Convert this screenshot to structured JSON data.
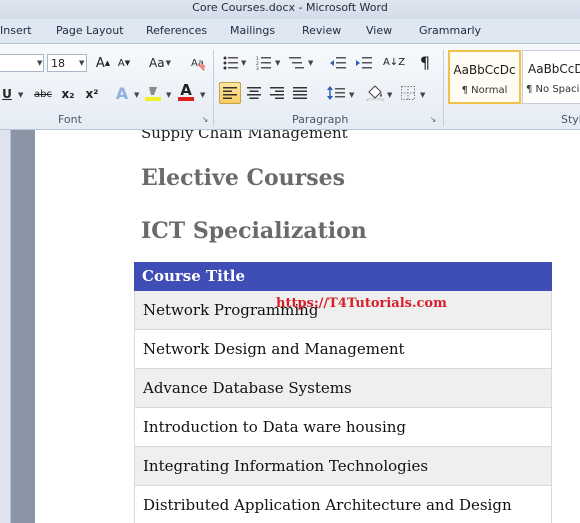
{
  "window": {
    "title": "Core Courses.docx - Microsoft Word"
  },
  "ribbon_tabs": [
    "Insert",
    "Page Layout",
    "References",
    "Mailings",
    "Review",
    "View",
    "Grammarly"
  ],
  "font_group": {
    "size": "18",
    "label": "Font",
    "change_case": "Aa",
    "grow_font": "A",
    "shrink_font": "A",
    "underline": "U",
    "strike": "abc",
    "subscript": "x₂",
    "superscript": "x²",
    "effects": "A",
    "font_color": "A"
  },
  "paragraph_group": {
    "label": "Paragraph",
    "sort": "A↓Z",
    "pilcrow": "¶"
  },
  "styles_group": {
    "label": "Styl",
    "items": [
      {
        "sample": "AaBbCcDc",
        "name": "¶ Normal"
      },
      {
        "sample": "AaBbCcDc",
        "name": "¶ No Spaci"
      }
    ]
  },
  "document": {
    "cut_line": "Supply Chain Management",
    "heading1": "Elective Courses",
    "heading2": "ICT Specialization",
    "table_header": "Course Title",
    "rows": [
      "Network Programming",
      "Network Design and Management",
      "Advance Database Systems",
      "Introduction to Data ware housing",
      "Integrating Information Technologies",
      "Distributed Application Architecture and Design"
    ],
    "watermark": "https://T4Tutorials.com"
  },
  "colors": {
    "table_header": "#3f4db7",
    "watermark": "#d6202a",
    "heading": "#6a6a6a"
  }
}
